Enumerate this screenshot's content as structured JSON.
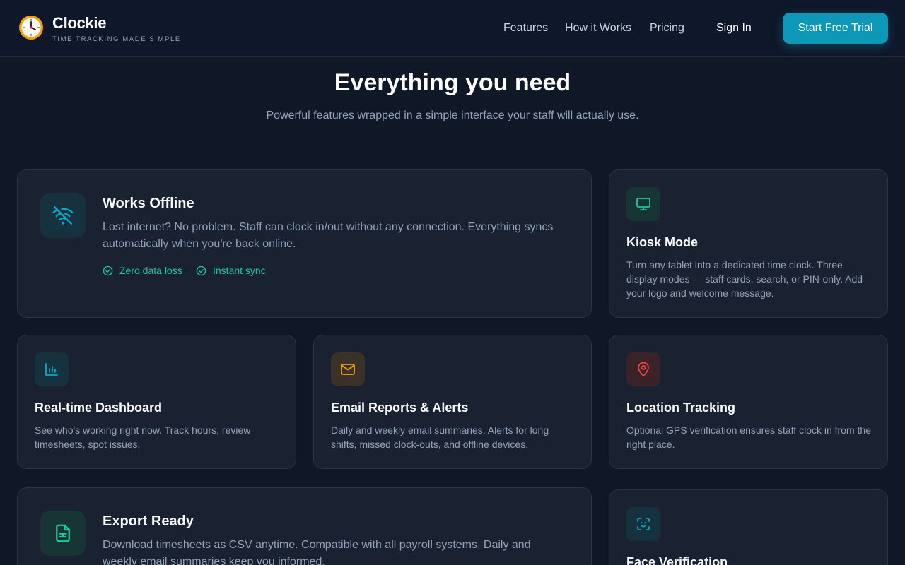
{
  "brand": {
    "name": "Clockie",
    "tagline": "TIME TRACKING MADE SIMPLE",
    "logo_icon": "clock-icon"
  },
  "nav": {
    "items": [
      {
        "label": "Features"
      },
      {
        "label": "How it Works"
      },
      {
        "label": "Pricing"
      }
    ],
    "signin_label": "Sign In",
    "cta_label": "Start Free Trial"
  },
  "section": {
    "title": "Everything you need",
    "subtitle": "Powerful features wrapped in a simple interface your staff will actually use."
  },
  "features": [
    {
      "title": "Works Offline",
      "description": "Lost internet? No problem. Staff can clock in/out without any connection. Everything syncs automatically when you're back online.",
      "icon": "wifi-off-icon",
      "accent": "#0ea5c6",
      "highlights": [
        "Zero data loss",
        "Instant sync"
      ]
    },
    {
      "title": "Kiosk Mode",
      "description": "Turn any tablet into a dedicated time clock. Three display modes — staff cards, search, or PIN-only. Add your logo and welcome message.",
      "icon": "monitor-icon",
      "accent": "#22c59e"
    },
    {
      "title": "Real-time Dashboard",
      "description": "See who's working right now. Track hours, review timesheets, spot issues.",
      "icon": "bar-chart-icon",
      "accent": "#0ea5c6"
    },
    {
      "title": "Email Reports & Alerts",
      "description": "Daily and weekly email summaries. Alerts for long shifts, missed clock-outs, and offline devices.",
      "icon": "mail-icon",
      "accent": "#f59e0b"
    },
    {
      "title": "Location Tracking",
      "description": "Optional GPS verification ensures staff clock in from the right place.",
      "icon": "map-pin-icon",
      "accent": "#ef4444"
    },
    {
      "title": "Export Ready",
      "description": "Download timesheets as CSV anytime. Compatible with all payroll systems. Daily and weekly email summaries keep you informed.",
      "icon": "file-spreadsheet-icon",
      "accent": "#22c59e"
    },
    {
      "title": "Face Verification",
      "icon": "face-scan-icon",
      "accent": "#0ea5c6"
    }
  ]
}
